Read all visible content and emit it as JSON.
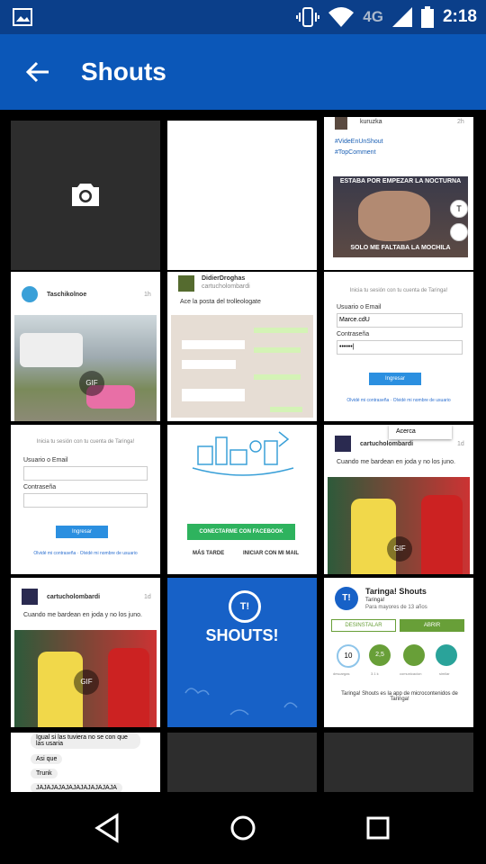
{
  "status_bar": {
    "network": "4G",
    "time": "2:18",
    "icons": [
      "gallery-icon",
      "vibrate-icon",
      "wifi-icon",
      "signal-icon",
      "battery-icon"
    ]
  },
  "app_bar": {
    "title": "Shouts",
    "back_icon": "arrow-back-icon"
  },
  "tiles": {
    "t3": {
      "user": "kuruzka",
      "time": "2h",
      "tags": "#VideEnUnShout\n#TopComment",
      "meme_top": "ESTABA POR EMPEZAR LA NOCTURNA",
      "meme_bottom": "SOLO ME FALTABA LA MOCHILA"
    },
    "t4": {
      "user": "Taschikolnoe",
      "time": "1h",
      "badge": "GIF"
    },
    "t5": {
      "user": "DidierDroghas",
      "handle": "cartucholombardi",
      "text": "Ace la posta del trolleologate"
    },
    "t6": {
      "header": "Inicia tu sesión con tu cuenta de Taringa!",
      "user_label": "Usuario o Email",
      "user_value": "Marce.cdU",
      "pass_label": "Contraseña",
      "pass_value": "••••••|",
      "button": "Ingresar",
      "links": "Olvidé mi contraseña · Olvidé mi nombre de usuario"
    },
    "t7": {
      "header": "Inicia tu sesión con tu cuenta de Taringa!",
      "user_label": "Usuario o Email",
      "pass_label": "Contraseña",
      "button": "Ingresar",
      "links": "Olvidé mi contraseña · Olvidé mi nombre de usuario"
    },
    "t8": {
      "facebook": "CONECTARME CON FACEBOOK",
      "later": "MÁS TARDE",
      "email": "INICIAR CON MI MAIL"
    },
    "t9": {
      "menu": "Acerca",
      "user": "cartucholombardi",
      "time": "1d",
      "text": "Cuando me bardean en joda y no los juno.",
      "badge": "GIF"
    },
    "t10": {
      "user": "cartucholombardi",
      "time": "1d",
      "text": "Cuando me bardean en joda y no los juno.",
      "badge": "GIF"
    },
    "t11": {
      "text": "SHOUTS!",
      "logo": "T!"
    },
    "t12": {
      "app": "Taringa! Shouts",
      "dev": "Taringa!",
      "age": "Para mayores de 13 años",
      "uninstall": "DESINSTALAR",
      "open": "ABRIR",
      "rating": "10",
      "downloads": "2,5",
      "desc": "Taringa! Shouts es la app de microcontenidos de Taringa!",
      "stats": [
        "descargas",
        "3.1 k",
        "comunicacion",
        "similar"
      ]
    },
    "t13": {
      "lines": [
        "Igual si las tuviera no se con que las usaria",
        "Asi que",
        "Trunk",
        "JAJAJAJAJAJAJAJAJAJAJA"
      ]
    }
  },
  "nav": {
    "icons": [
      "back-triangle-icon",
      "home-circle-icon",
      "recents-square-icon"
    ]
  }
}
